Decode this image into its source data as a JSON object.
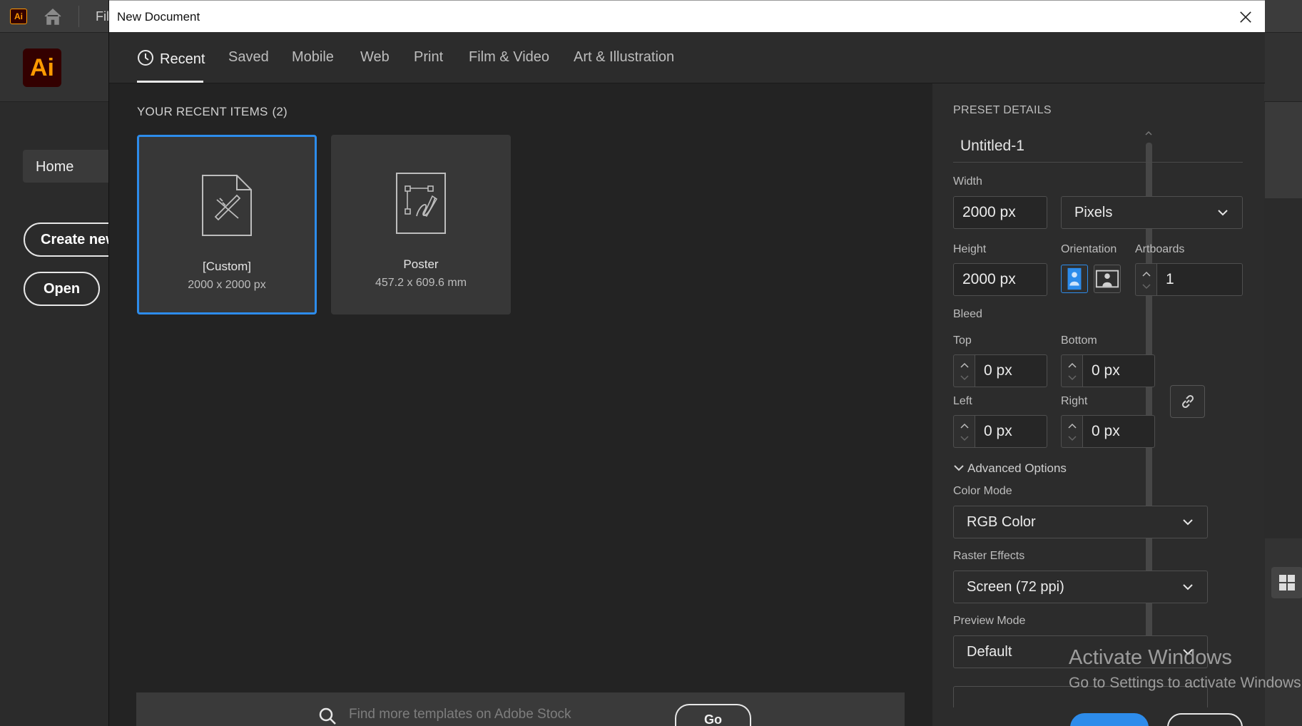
{
  "app": {
    "small_logo": "Ai",
    "big_logo": "Ai",
    "file_menu": "Fil",
    "sidebar_home": "Home",
    "create_new_label": "Create new",
    "open_label": "Open"
  },
  "dialog": {
    "title": "New Document",
    "close_icon": "close-icon"
  },
  "tabs": [
    {
      "label": "Recent",
      "active": true
    },
    {
      "label": "Saved"
    },
    {
      "label": "Mobile"
    },
    {
      "label": "Web"
    },
    {
      "label": "Print"
    },
    {
      "label": "Film & Video"
    },
    {
      "label": "Art & Illustration"
    }
  ],
  "recent": {
    "heading": "YOUR RECENT ITEMS",
    "count": "(2)",
    "items": [
      {
        "name": "[Custom]",
        "size": "2000 x 2000 px",
        "selected": true,
        "icon": "custom-document-icon"
      },
      {
        "name": "Poster",
        "size": "457.2 x 609.6 mm",
        "selected": false,
        "icon": "poster-document-icon"
      }
    ]
  },
  "search": {
    "placeholder": "Find more templates on Adobe Stock",
    "go_label": "Go"
  },
  "preset": {
    "heading": "PRESET DETAILS",
    "doc_name": "Untitled-1",
    "width_label": "Width",
    "width_value": "2000 px",
    "units_value": "Pixels",
    "height_label": "Height",
    "height_value": "2000 px",
    "orientation_label": "Orientation",
    "orientation_selected": "portrait",
    "artboards_label": "Artboards",
    "artboards_value": "1",
    "bleed_label": "Bleed",
    "bleed_top_label": "Top",
    "bleed_top_value": "0 px",
    "bleed_bottom_label": "Bottom",
    "bleed_bottom_value": "0 px",
    "bleed_left_label": "Left",
    "bleed_left_value": "0 px",
    "bleed_right_label": "Right",
    "bleed_right_value": "0 px",
    "advanced_label": "Advanced Options",
    "color_mode_label": "Color Mode",
    "color_mode_value": "RGB Color",
    "raster_label": "Raster Effects",
    "raster_value": "Screen (72 ppi)",
    "preview_label": "Preview Mode",
    "preview_value": "Default"
  },
  "watermark": {
    "line1": "Activate Windows",
    "line2": "Go to Settings to activate Windows."
  },
  "colors": {
    "accent": "#2d8ceb",
    "dialog_bg": "#232323",
    "panel_bg": "#2c2c2c",
    "brand_orange": "#ff9a00"
  }
}
